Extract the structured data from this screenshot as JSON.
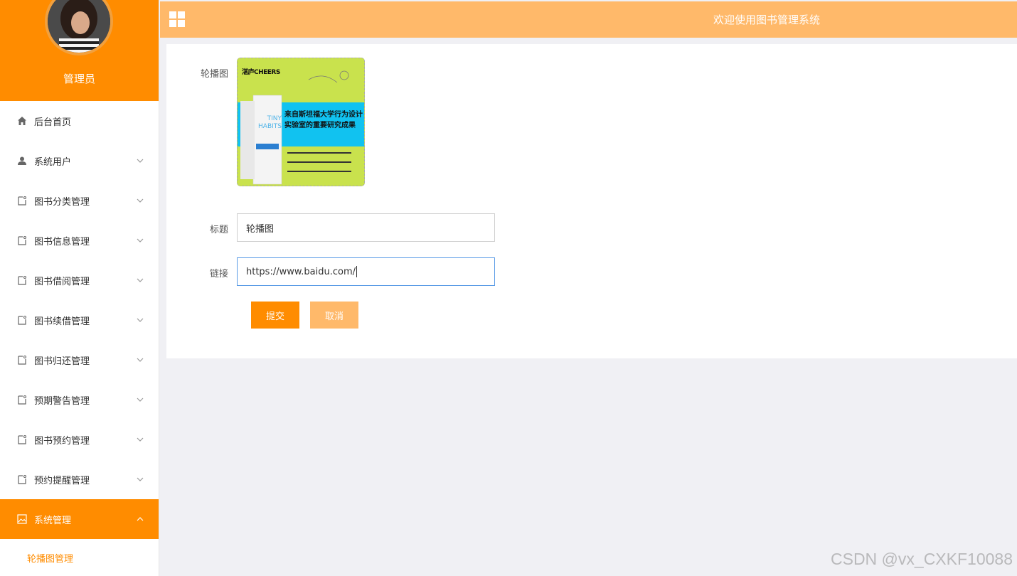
{
  "sidebar": {
    "profile_name": "管理员",
    "items": [
      {
        "label": "后台首页",
        "icon": "home-icon"
      },
      {
        "label": "系统用户",
        "icon": "user-icon"
      },
      {
        "label": "图书分类管理",
        "icon": "doc-icon"
      },
      {
        "label": "图书信息管理",
        "icon": "doc-icon"
      },
      {
        "label": "图书借阅管理",
        "icon": "doc-icon"
      },
      {
        "label": "图书续借管理",
        "icon": "doc-icon"
      },
      {
        "label": "图书归还管理",
        "icon": "doc-icon"
      },
      {
        "label": "预期警告管理",
        "icon": "doc-icon"
      },
      {
        "label": "图书预约管理",
        "icon": "doc-icon"
      },
      {
        "label": "预约提醒管理",
        "icon": "doc-icon"
      },
      {
        "label": "系统管理",
        "icon": "picture-icon"
      }
    ],
    "submenu": [
      {
        "label": "轮播图管理"
      }
    ]
  },
  "header": {
    "title": "欢迎使用图书管理系统"
  },
  "form": {
    "image_label": "轮播图",
    "title_label": "标题",
    "title_value": "轮播图",
    "link_label": "链接",
    "link_value": "https://www.baidu.com/",
    "submit_label": "提交",
    "cancel_label": "取消"
  },
  "banner_image": {
    "publisher": "湛庐CHEERS",
    "cover_title": "TINY HABITS",
    "headline": "来自斯坦福大学行为设计实验室的重要研究成果"
  },
  "watermark": "CSDN @vx_CXKF10088",
  "colors": {
    "accent": "#ff8c00",
    "accent_light": "#ffb96a"
  }
}
